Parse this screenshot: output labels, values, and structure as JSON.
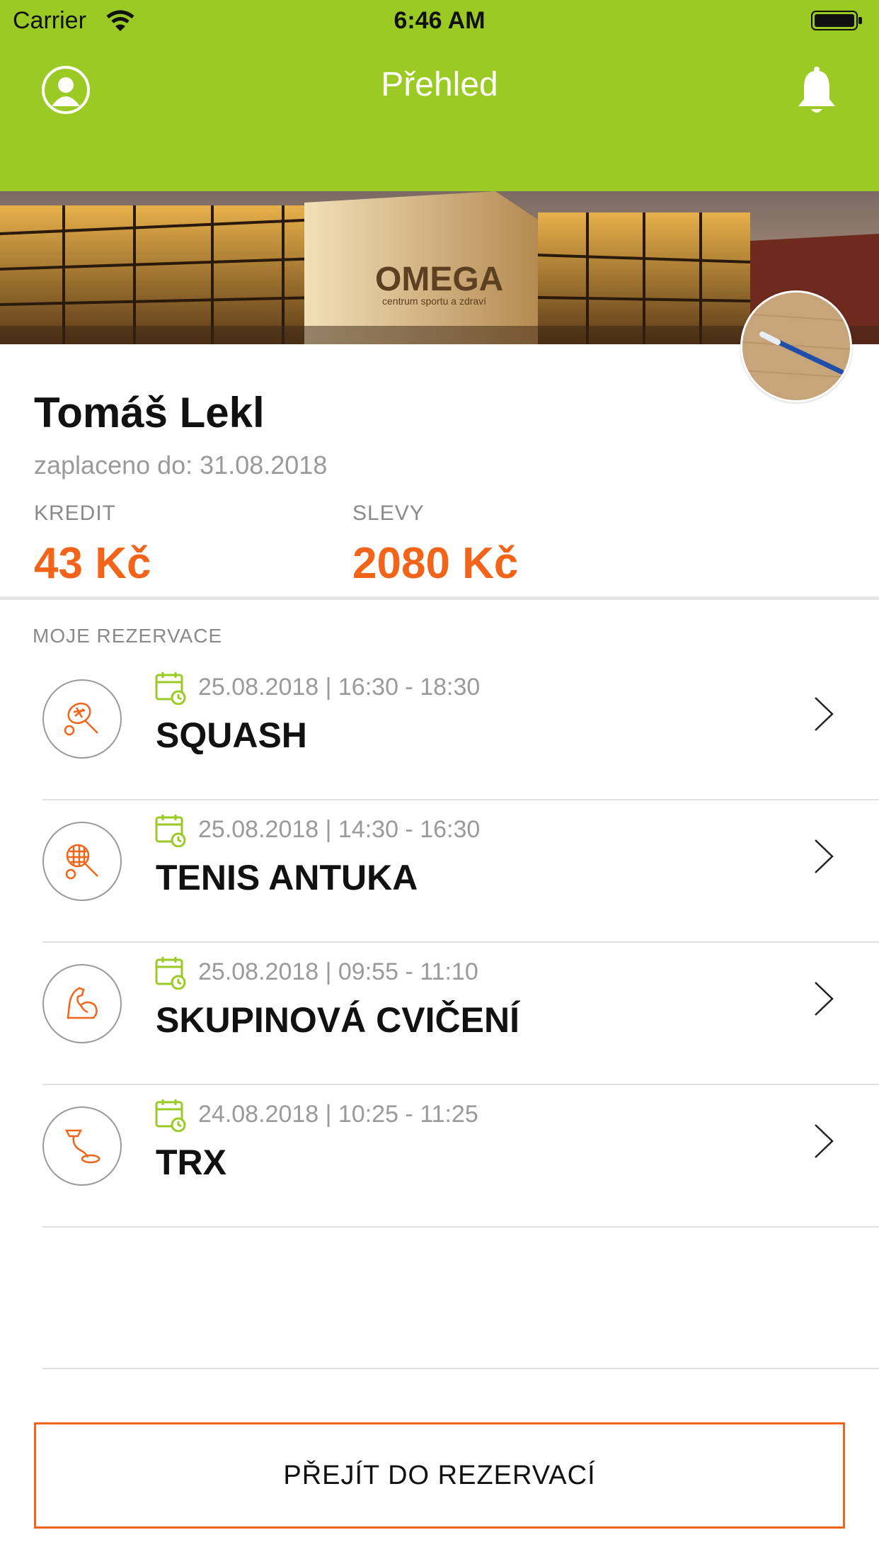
{
  "status_bar": {
    "carrier": "Carrier",
    "time": "6:46 AM"
  },
  "header": {
    "title": "Přehled",
    "color": "#9aca23"
  },
  "hero": {
    "sign_text": "OMEGA",
    "sign_subtext": "centrum sportu a zdraví"
  },
  "user": {
    "name": "Tomáš Lekl",
    "paid_until": "zaplaceno do: 31.08.2018",
    "kredit_label": "KREDIT",
    "kredit_value": "43 Kč",
    "slevy_label": "SLEVY",
    "slevy_value": "2080 Kč"
  },
  "reservations": {
    "title": "MOJE REZERVACE",
    "items": [
      {
        "date": "25.08.2018 | 16:30 - 18:30",
        "name": "SQUASH",
        "icon": "squash-racket-icon"
      },
      {
        "date": "25.08.2018 | 14:30 - 16:30",
        "name": "TENIS ANTUKA",
        "icon": "tennis-racket-icon"
      },
      {
        "date": "25.08.2018 | 09:55 - 11:10",
        "name": "SKUPINOVÁ CVIČENÍ",
        "icon": "flexed-arm-icon"
      },
      {
        "date": "24.08.2018 | 10:25 - 11:25",
        "name": "TRX",
        "icon": "trx-strap-icon"
      }
    ]
  },
  "cta": {
    "label": "PŘEJÍT DO REZERVACÍ"
  },
  "colors": {
    "accent": "#f26419",
    "green": "#9aca23",
    "muted": "#9a9a9a"
  }
}
